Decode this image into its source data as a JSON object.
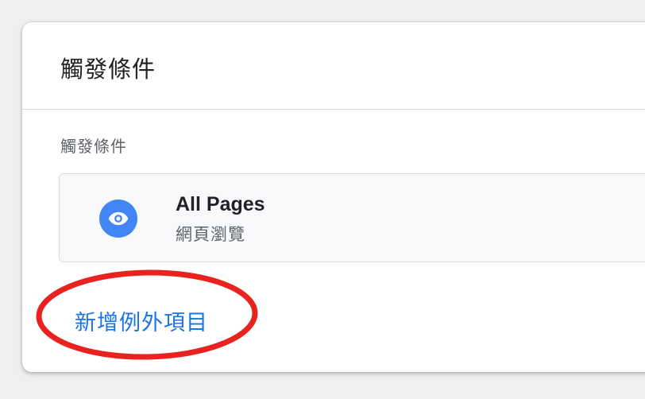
{
  "card": {
    "title": "觸發條件",
    "section_label": "觸發條件"
  },
  "trigger": {
    "name": "All Pages",
    "type": "網頁瀏覽",
    "icon": "eye-icon",
    "icon_color": "#4285f4"
  },
  "actions": {
    "add_exception_label": "新增例外項目",
    "link_color": "#1a73e8"
  },
  "annotation": {
    "shape": "ellipse",
    "color": "#e8231f"
  }
}
